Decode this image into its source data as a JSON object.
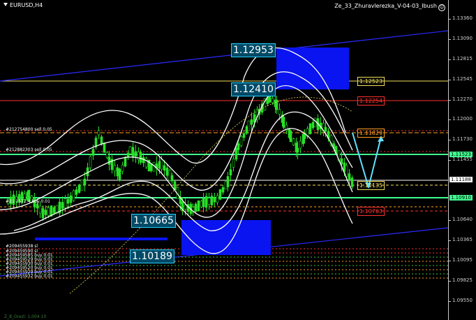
{
  "window": {
    "symbol": "EURUSD,H4",
    "indicator": "Ze_33_Zhuravlerezka_V-04-03_Ibush",
    "smiley": "☺",
    "footer": "Z_8_Orezl: 1,004 10"
  },
  "price_axis": {
    "labels": [
      "1.13360",
      "1.13090",
      "1.12815",
      "1.12545",
      "1.12270",
      "1.12000",
      "1.11730",
      "1.11455",
      "1.11188",
      "1.10910",
      "1.10640",
      "1.10365",
      "1.10095",
      "1.09825",
      "1.09550"
    ]
  },
  "extremes": {
    "high": "1.12953",
    "mid_high": "1.12410",
    "mid_low": "1.10665",
    "low": "1.10189"
  },
  "levels": [
    {
      "value": "1.12523",
      "color": "#f0e060"
    },
    {
      "value": "1.12254",
      "color": "#ff3030"
    },
    {
      "value": "1.11829",
      "color": "#ffa020"
    },
    {
      "value": "1.11523",
      "color": "#40ff90",
      "filled": true
    },
    {
      "value": "1.11188",
      "color": "#ffffff",
      "filled": true
    },
    {
      "value": "1.11135",
      "color": "#f0e060"
    },
    {
      "value": "1.10955",
      "color": "#ffffff",
      "filled": true,
      "axis_on": true
    },
    {
      "value": "1.10763",
      "color": "#ff3030"
    }
  ],
  "orders": [
    "#212754800 sell 0.05",
    "#212882303 sell 0.05",
    "#21 1572.4 buy 0.01",
    "#209455938 sl",
    "#209459590 sl",
    "#209459585 buy 0.01",
    "#209459529 buy 0.01",
    "#209455930 buy 0.01",
    "#209459520 buy 0.01",
    "#209455929 buy 0.01",
    "#209455932 buy 0.01"
  ],
  "colors": {
    "background": "#000000",
    "candles": "#28e028",
    "bands": "#ffffff",
    "channel": "#2a2aff",
    "box": "#0a14f0",
    "arrow": "#60e0ff"
  }
}
